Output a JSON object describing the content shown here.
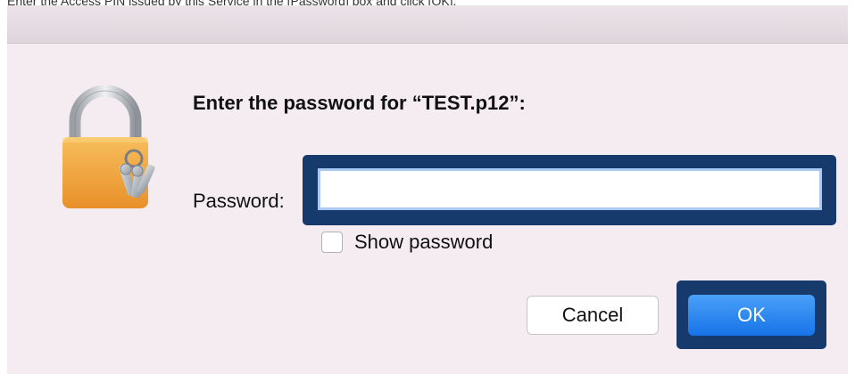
{
  "instruction": {
    "text": "Enter the Access PIN issued by this Service in the [Password] box and click [OK]."
  },
  "dialog": {
    "title": "Enter the password for “TEST.p12”:",
    "icon": "keychain-lock-icon",
    "password_label": "Password:",
    "password_value": "",
    "show_password_label": "Show password",
    "show_password_checked": false,
    "cancel_label": "Cancel",
    "ok_label": "OK"
  },
  "colors": {
    "dialog_background": "#f4ecf1",
    "highlight_border": "#163a6b",
    "ok_button": "#1773e8",
    "field_focus": "#a9c9f2",
    "lock_body": "#f2a43a"
  }
}
